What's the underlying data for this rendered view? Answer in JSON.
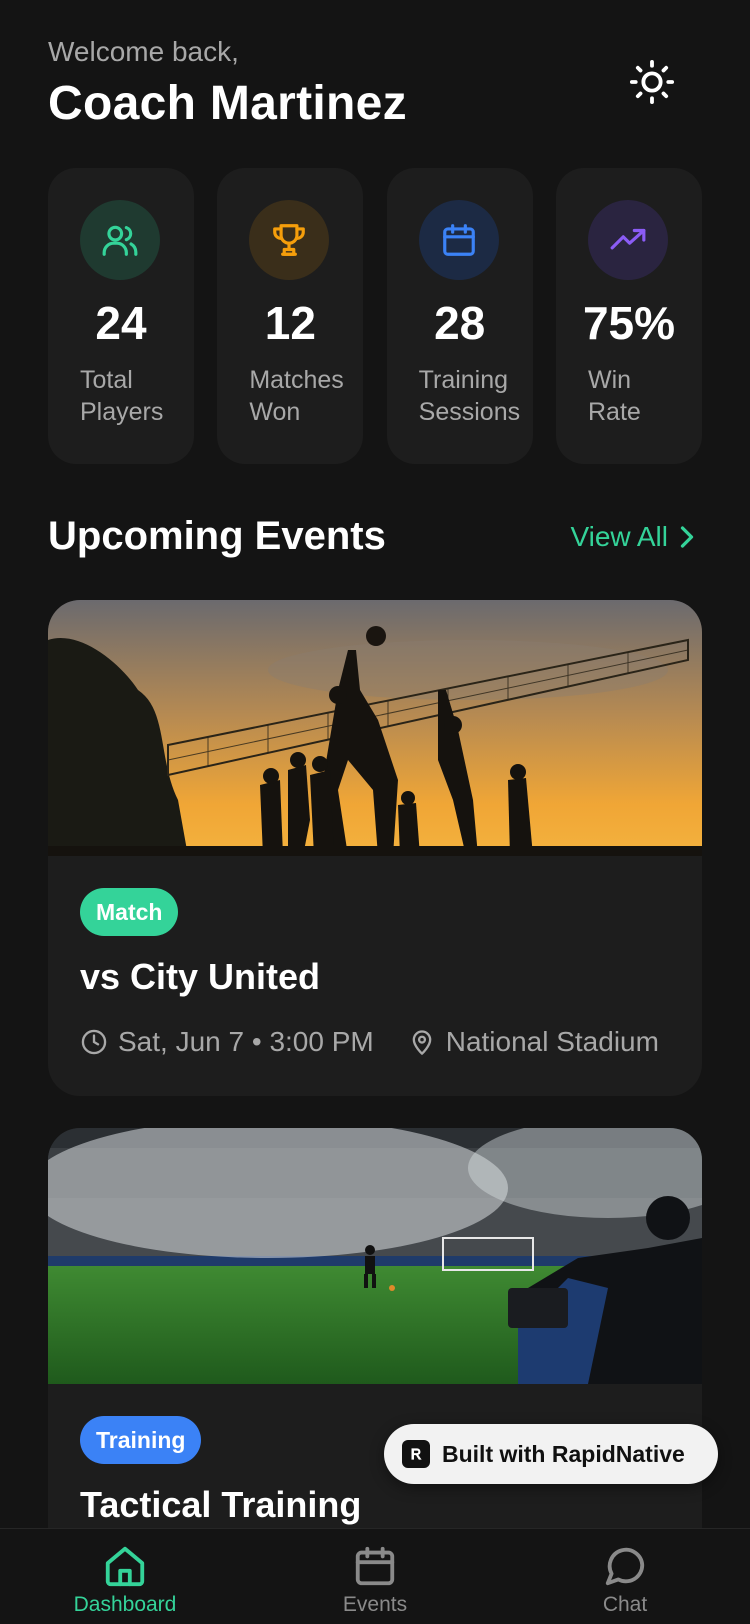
{
  "header": {
    "welcome": "Welcome back,",
    "coach_name": "Coach Martinez",
    "theme_icon": "sun-icon"
  },
  "stats": [
    {
      "icon": "users-icon",
      "value": "24",
      "label_line1": "Total",
      "label_line2": "Players",
      "color": "#34d399",
      "bg": "#1f3a30"
    },
    {
      "icon": "trophy-icon",
      "value": "12",
      "label_line1": "Matches",
      "label_line2": "Won",
      "color": "#f59e0b",
      "bg": "#3a2e1a"
    },
    {
      "icon": "calendar-icon",
      "value": "28",
      "label_line1": "Training",
      "label_line2": "Sessions",
      "color": "#3b82f6",
      "bg": "#1c2a44"
    },
    {
      "icon": "trending-up-icon",
      "value": "75%",
      "label_line1": "Win",
      "label_line2": "Rate",
      "color": "#8b5cf6",
      "bg": "#2a2440"
    }
  ],
  "events_section": {
    "title": "Upcoming Events",
    "view_all": "View All"
  },
  "events": [
    {
      "tag": "Match",
      "title": "vs City United",
      "datetime": "Sat, Jun 7 • 3:00 PM",
      "location": "National Stadium"
    },
    {
      "tag": "Training",
      "title": "Tactical Training"
    }
  ],
  "badge": {
    "label": "Built with RapidNative"
  },
  "tabs": [
    {
      "label": "Dashboard",
      "icon": "home-icon",
      "active": true
    },
    {
      "label": "Events",
      "icon": "calendar-icon",
      "active": false
    },
    {
      "label": "Chat",
      "icon": "chat-bubble-icon",
      "active": false
    }
  ],
  "colors": {
    "accent": "#34d399",
    "training": "#3b82f6",
    "background": "#141414",
    "card": "#1d1d1d"
  }
}
